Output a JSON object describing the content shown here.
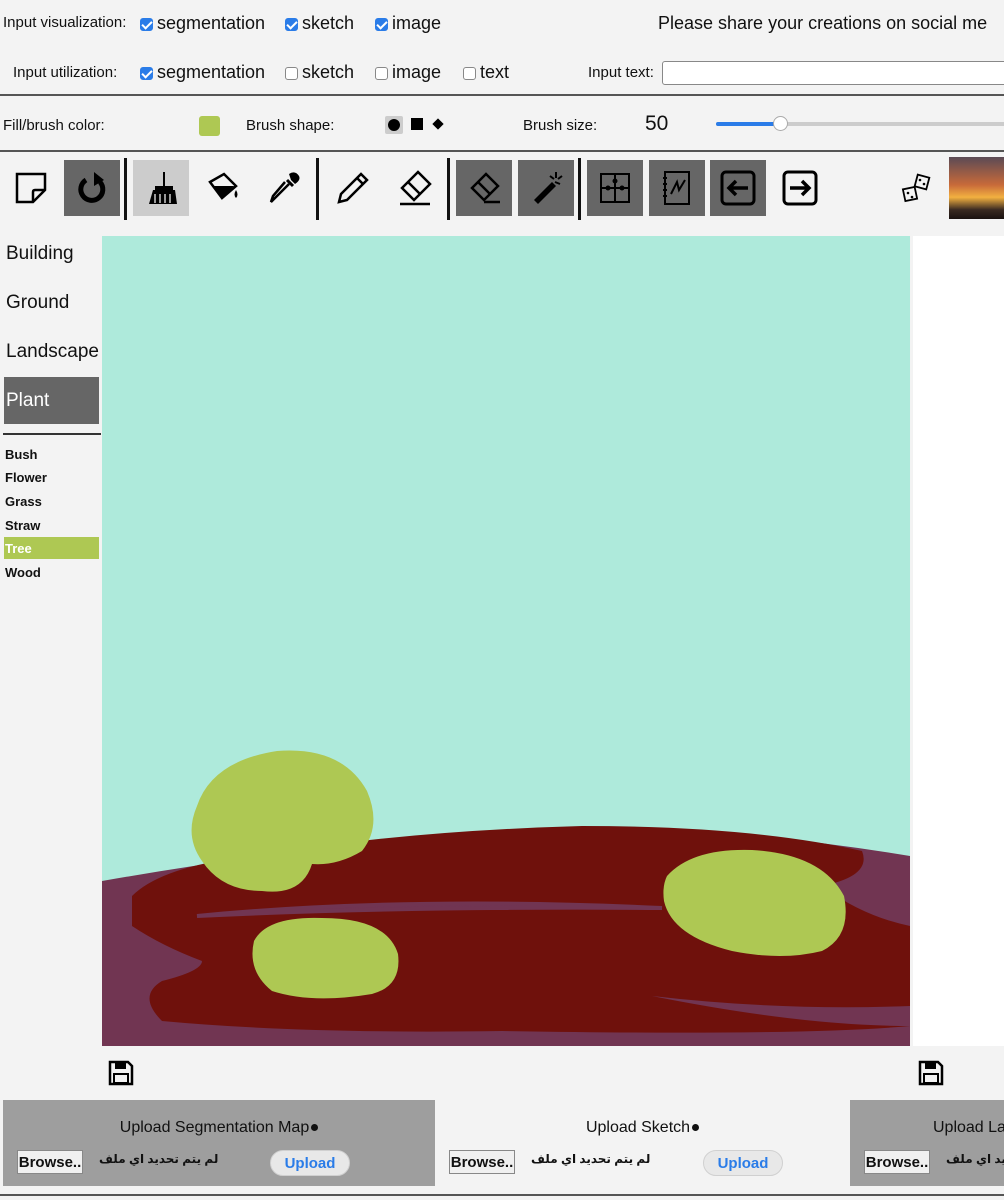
{
  "header": {
    "input_visualization_label": "Input visualization:",
    "visualization_options": [
      {
        "label": "segmentation",
        "checked": true
      },
      {
        "label": "sketch",
        "checked": true
      },
      {
        "label": "image",
        "checked": true
      }
    ],
    "share_message": "Please share your creations on social me",
    "input_utilization_label": "Input utilization:",
    "utilization_options": [
      {
        "label": "segmentation",
        "checked": true
      },
      {
        "label": "sketch",
        "checked": false
      },
      {
        "label": "image",
        "checked": false
      },
      {
        "label": "text",
        "checked": false
      }
    ],
    "input_text_label": "Input text:",
    "input_text_value": ""
  },
  "brush": {
    "fill_label": "Fill/brush color:",
    "fill_color": "#aec853",
    "shape_label": "Brush shape:",
    "shapes": [
      "circle",
      "square",
      "diamond"
    ],
    "selected_shape": "circle",
    "size_label": "Brush size:",
    "size_value": "50"
  },
  "toolbar": {
    "tools": [
      {
        "name": "new-canvas-icon",
        "state": "none"
      },
      {
        "name": "redo-icon",
        "state": "dark"
      },
      {
        "name": "brush-icon",
        "state": "light"
      },
      {
        "name": "fill-bucket-icon",
        "state": "none"
      },
      {
        "name": "eyedropper-icon",
        "state": "none"
      },
      {
        "name": "pencil-icon",
        "state": "none"
      },
      {
        "name": "sketch-eraser-icon",
        "state": "none"
      },
      {
        "name": "eraser-icon",
        "state": "dark"
      },
      {
        "name": "magic-wand-icon",
        "state": "dark"
      },
      {
        "name": "puzzle-icon",
        "state": "dark"
      },
      {
        "name": "sketchbook-icon",
        "state": "dark"
      },
      {
        "name": "arrow-left-icon",
        "state": "dark"
      },
      {
        "name": "arrow-right-icon",
        "state": "none"
      },
      {
        "name": "dice-icon",
        "state": "none"
      }
    ]
  },
  "categories": {
    "groups": [
      "Building",
      "Ground",
      "Landscape",
      "Plant"
    ],
    "selected_group": "Plant",
    "items": [
      "Bush",
      "Flower",
      "Grass",
      "Straw",
      "Tree",
      "Wood"
    ],
    "selected_item": "Tree"
  },
  "canvas": {
    "colors": {
      "sky": "#aeeadb",
      "ground": "#713552",
      "dirt": "#6f110c",
      "tree": "#aec853"
    }
  },
  "uploads": [
    {
      "title": "Upload Segmentation Map",
      "browse": "Browse..",
      "no_file": "لم يتم تحديد اي ملف",
      "button": "Upload"
    },
    {
      "title": "Upload Sketch",
      "browse": "Browse..",
      "no_file": "لم يتم تحديد اي ملف",
      "button": "Upload"
    },
    {
      "title": "Upload La",
      "browse": "Browse..",
      "no_file": "لم يتم تحديد اي ملف"
    }
  ]
}
